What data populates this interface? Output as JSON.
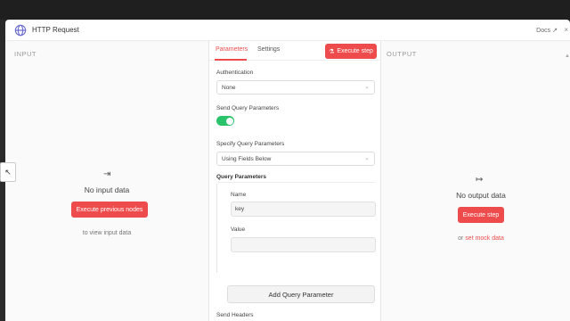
{
  "header": {
    "title": "HTTP Request",
    "docs_label": "Docs"
  },
  "input_panel": {
    "label": "INPUT",
    "empty_title": "No input data",
    "button_label": "Execute previous nodes",
    "hint": "to view input data"
  },
  "tabs": [
    {
      "label": "Parameters",
      "active": true
    },
    {
      "label": "Settings",
      "active": false
    }
  ],
  "execute_step_label": "Execute step",
  "params": {
    "authentication_label": "Authentication",
    "authentication_value": "None",
    "send_query_label": "Send Query Parameters",
    "send_query_on": true,
    "specify_query_label": "Specify Query Parameters",
    "specify_query_value": "Using Fields Below",
    "query_params_label": "Query Parameters",
    "name_label": "Name",
    "name_value": "key",
    "value_label": "Value",
    "value_value": "",
    "add_button_label": "Add Query Parameter",
    "send_headers_label": "Send Headers",
    "send_headers_on": false
  },
  "output_panel": {
    "label": "OUTPUT",
    "empty_title": "No output data",
    "button_label": "Execute step",
    "hint_prefix": "or",
    "hint_link": "set mock data"
  },
  "colors": {
    "accent": "#ee4c4c",
    "toggle_on": "#29c46a"
  }
}
